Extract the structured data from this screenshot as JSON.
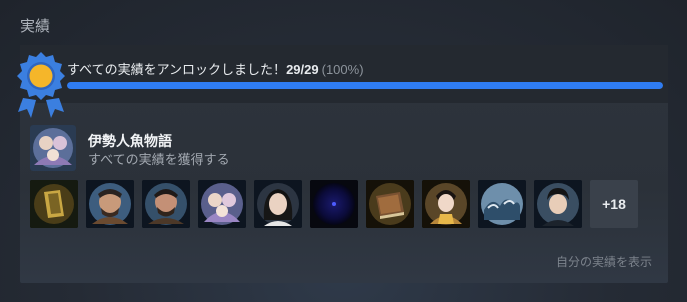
{
  "section": {
    "title": "実績"
  },
  "progress": {
    "text": "すべての実績をアンロックしました！",
    "count": "29/29",
    "percent_label": "(100%)",
    "fraction": 1.0,
    "bar_color": "#2f7cf2",
    "medal_colors": {
      "outer": "#3b7fe0",
      "inner": "#f5b62a"
    }
  },
  "game": {
    "title": "伊勢人魚物語",
    "subtitle": "すべての実績を獲得する"
  },
  "achievements": {
    "icons": [
      {
        "name": "gold-crest-achievement-icon"
      },
      {
        "name": "bearded-man-achievement-icon"
      },
      {
        "name": "bearded-man-smile-achievement-icon"
      },
      {
        "name": "mermaid-group-achievement-icon"
      },
      {
        "name": "dark-haired-girl-achievement-icon"
      },
      {
        "name": "dark-orb-achievement-icon"
      },
      {
        "name": "old-book-achievement-icon"
      },
      {
        "name": "kimono-woman-achievement-icon"
      },
      {
        "name": "wave-crest-achievement-icon"
      },
      {
        "name": "young-man-achievement-icon"
      }
    ],
    "more_label": "+18"
  },
  "footer": {
    "show_link": "自分の実績を表示"
  }
}
